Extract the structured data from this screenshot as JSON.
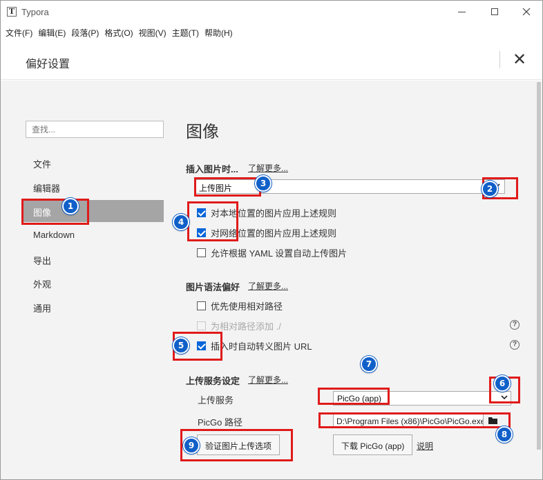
{
  "window": {
    "app_logo": "T",
    "app_title": "Typora"
  },
  "menu": [
    {
      "label": "文件(F)"
    },
    {
      "label": "编辑(E)"
    },
    {
      "label": "段落(P)"
    },
    {
      "label": "格式(O)"
    },
    {
      "label": "视图(V)"
    },
    {
      "label": "主题(T)"
    },
    {
      "label": "帮助(H)"
    }
  ],
  "preferences": {
    "title": "偏好设置",
    "close_glyph": "✕"
  },
  "sidebar": {
    "search_placeholder": "查找...",
    "items": [
      {
        "label": "文件"
      },
      {
        "label": "编辑器"
      },
      {
        "label": "图像"
      },
      {
        "label": "Markdown"
      },
      {
        "label": "导出"
      },
      {
        "label": "外观"
      },
      {
        "label": "通用"
      }
    ],
    "active_item": "图像"
  },
  "content": {
    "heading": "图像",
    "insert_image": {
      "label": "插入图片时...",
      "learn_more": "了解更多...",
      "action_selected": "上传图片",
      "apply_local": {
        "label": "对本地位置的图片应用上述规则",
        "checked": true
      },
      "apply_network": {
        "label": "对网络位置的图片应用上述规则",
        "checked": true
      },
      "allow_yaml": {
        "label": "允许根据 YAML 设置自动上传图片",
        "checked": false
      }
    },
    "syntax_pref": {
      "label": "图片语法偏好",
      "learn_more": "了解更多...",
      "relative_path": {
        "label": "优先使用相对路径",
        "checked": false
      },
      "add_dot_slash": {
        "label": "为相对路径添加 ./",
        "checked": false,
        "disabled": true
      },
      "escape_url": {
        "label": "插入时自动转义图片 URL",
        "checked": true
      },
      "help_glyph": "?"
    },
    "upload_service": {
      "label": "上传服务设定",
      "learn_more": "了解更多...",
      "service_label": "上传服务",
      "service_selected": "PicGo (app)",
      "path_label": "PicGo 路径",
      "path_value": "D:\\Program Files (x86)\\PicGo\\PicGo.exe",
      "verify_button": "验证图片上传选项",
      "download_button": "下载 PicGo (app)",
      "help_link": "说明"
    }
  },
  "annotations": {
    "color": "#e01a1a",
    "badge_color": "#1160c9",
    "badges": [
      {
        "number": "1"
      },
      {
        "number": "2"
      },
      {
        "number": "3"
      },
      {
        "number": "4"
      },
      {
        "number": "5"
      },
      {
        "number": "6"
      },
      {
        "number": "7"
      },
      {
        "number": "8"
      },
      {
        "number": "9"
      }
    ]
  }
}
